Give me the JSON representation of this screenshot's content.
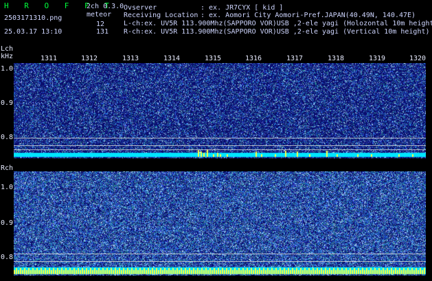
{
  "header": {
    "brand": "H R O F F T",
    "mode": "2ch 0.3.0",
    "mode_sub": "meteor",
    "filename": "2503171310.png",
    "datetime": "25.03.17 13:10",
    "count_l": "12",
    "count_r": "131",
    "observer_label": "Ovserver",
    "observer_value": ": ex. JR7CYX [ kid ]",
    "location_label": "Receiving Location",
    "location_value": ": ex. Aomori City Aomori-Pref.JAPAN(40.49N, 140.47E)",
    "lch_info": "L-ch:ex. UV5R 113.900Mhz(SAPPORO VOR)USB ,2-ele yagi (Holozontal 10m height)",
    "rch_info": "R-ch:ex. UV5R 113.900Mhz(SAPPORO VOR)USB ,2-ele yagi (Vertical 10m height)"
  },
  "lch": {
    "label": "Lch",
    "unit": "kHz",
    "y_ticks": [
      "1.0",
      "0.9",
      "0.8"
    ],
    "time_ticks": [
      "1311",
      "1312",
      "1313",
      "1314",
      "1315",
      "1316",
      "1317",
      "1318",
      "1319",
      "1320"
    ]
  },
  "rch": {
    "label": "Rch",
    "y_ticks": [
      "1.0",
      "0.9",
      "0.8"
    ]
  },
  "colors": {
    "background": "#000000",
    "spectrum_bg": "#0a0e6e",
    "noise": "#2a6cff",
    "signal": "#00e5ff",
    "meteor": "#ffff40",
    "brand": "#00ff3c"
  }
}
